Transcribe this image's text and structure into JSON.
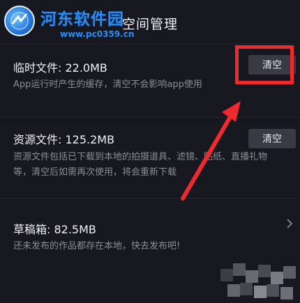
{
  "header": {
    "title": "空间管理",
    "watermark_name": "河东软件园",
    "watermark_url": "www.pc0359.cn"
  },
  "sections": [
    {
      "title": "临时文件: 22.0MB",
      "desc_lines": [
        "App运行时产生的缓存，清空不会影响app使用"
      ],
      "button": "清空"
    },
    {
      "title": "资源文件: 125.2MB",
      "desc_lines": [
        "资源文件包括已下载到本地的拍摄道具、滤镜、贴纸、直播礼物",
        "等，清空后如需再次使用，将会重新下载"
      ],
      "button": "清空"
    },
    {
      "title": "草稿箱: 82.5MB",
      "desc_lines": [
        "还未发布的作品都存在本地，快去发布吧!"
      ]
    }
  ],
  "colors": {
    "background": "#17171f",
    "button_bg": "#3a3a44",
    "annotation_red": "#ee2a2f",
    "watermark_blue": "#2b8df0"
  }
}
